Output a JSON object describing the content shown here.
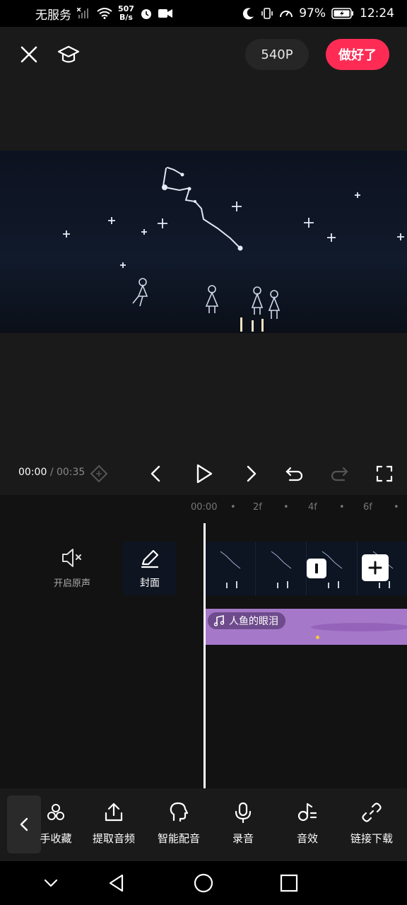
{
  "status_bar": {
    "carrier": "无服务",
    "net_speed_value": "507",
    "net_speed_unit": "B/s",
    "battery": "97%",
    "time": "12:24"
  },
  "top_bar": {
    "resolution": "540P",
    "done_label": "做好了"
  },
  "playback": {
    "current_time": "00:00",
    "separator": "/",
    "total_time": "00:35"
  },
  "timeline": {
    "ruler_labels": [
      "00:00",
      "2f",
      "4f",
      "6f"
    ],
    "mute_label": "开启原声",
    "cover_label": "封面",
    "music_track_name": "人鱼的眼泪"
  },
  "toolbar": {
    "items": [
      {
        "label": "手收藏",
        "icon": "favorites-icon"
      },
      {
        "label": "提取音频",
        "icon": "extract-audio-icon"
      },
      {
        "label": "智能配音",
        "icon": "smart-dubbing-icon"
      },
      {
        "label": "录音",
        "icon": "microphone-icon"
      },
      {
        "label": "音效",
        "icon": "sound-effect-icon"
      },
      {
        "label": "链接下载",
        "icon": "link-icon"
      }
    ]
  },
  "colors": {
    "done_button": "#fe2c55",
    "music_track": "#a678c9",
    "background": "#1a1a1a"
  }
}
